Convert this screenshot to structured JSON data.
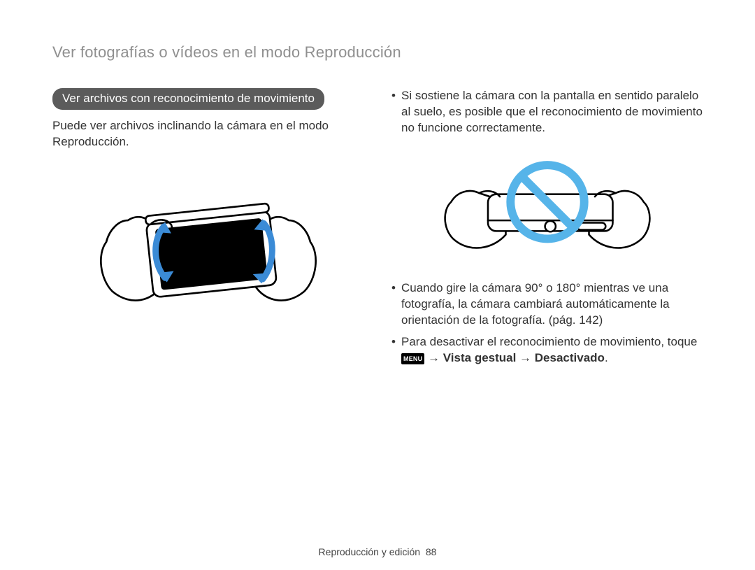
{
  "breadcrumb": "Ver fotografías o vídeos en el modo Reproducción",
  "left": {
    "section_title": "Ver archivos con reconocimiento de movimiento",
    "intro": "Puede ver archivos inclinando la cámara en el modo Reproducción."
  },
  "right": {
    "bullet1": "Si sostiene la cámara con la pantalla en sentido paralelo al suelo, es posible que el reconocimiento de movimiento no funcione correctamente.",
    "bullet2": "Cuando gire la cámara 90° o 180° mientras ve una fotografía, la cámara cambiará automáticamente la orientación de la fotografía. (pág. 142)",
    "bullet3_prefix": "Para desactivar el reconocimiento de movimiento, toque ",
    "menu_label": "MENU",
    "arrow": " → ",
    "bullet3_strong": "Vista gestual → Desactivado",
    "period": "."
  },
  "footer": {
    "section": "Reproducción y edición",
    "page": "88"
  }
}
